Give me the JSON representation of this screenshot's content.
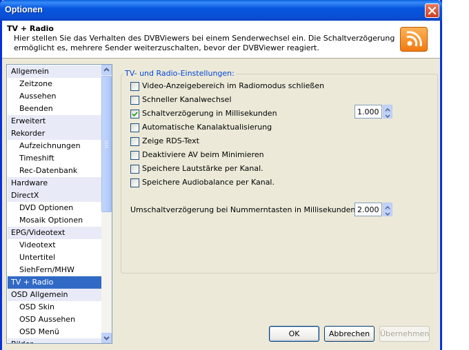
{
  "window": {
    "title": "Optionen"
  },
  "header": {
    "title": "TV + Radio",
    "description": "Hier stellen Sie das Verhalten des DVBViewers bei einem Senderwechsel ein. Die Schaltverzögerung ermöglicht es, mehrere Sender weiterzuschalten, bevor der DVBViewer reagiert."
  },
  "nav": {
    "items": [
      {
        "label": "Allgemein",
        "level": "cat"
      },
      {
        "label": "Zeitzone",
        "level": "sub"
      },
      {
        "label": "Aussehen",
        "level": "sub"
      },
      {
        "label": "Beenden",
        "level": "sub"
      },
      {
        "label": "Erweitert",
        "level": "cat"
      },
      {
        "label": "Rekorder",
        "level": "cat"
      },
      {
        "label": "Aufzeichnungen",
        "level": "sub"
      },
      {
        "label": "Timeshift",
        "level": "sub"
      },
      {
        "label": "Rec-Datenbank",
        "level": "sub"
      },
      {
        "label": "Hardware",
        "level": "cat"
      },
      {
        "label": "DirectX",
        "level": "cat"
      },
      {
        "label": "DVD Optionen",
        "level": "sub"
      },
      {
        "label": "Mosaik Optionen",
        "level": "sub"
      },
      {
        "label": "EPG/Videotext",
        "level": "cat"
      },
      {
        "label": "Videotext",
        "level": "sub"
      },
      {
        "label": "Untertitel",
        "level": "sub"
      },
      {
        "label": "SiehFern/MHW",
        "level": "sub"
      },
      {
        "label": "TV + Radio",
        "level": "sel"
      },
      {
        "label": "OSD Allgemein",
        "level": "cat"
      },
      {
        "label": "OSD Skin",
        "level": "sub"
      },
      {
        "label": "OSD Aussehen",
        "level": "sub"
      },
      {
        "label": "OSD Menü",
        "level": "sub"
      },
      {
        "label": "Bilder",
        "level": "cat"
      }
    ],
    "selected": "TV + Radio"
  },
  "group": {
    "legend": "TV- und Radio-Einstellungen:",
    "checkboxes": [
      {
        "label": "Video-Anzeigebereich im Radiomodus schließen",
        "checked": false
      },
      {
        "label": "Schneller Kanalwechsel",
        "checked": false
      },
      {
        "label": "Schaltverzögerung in Millisekunden",
        "checked": true
      },
      {
        "label": "Automatische Kanalaktualisierung",
        "checked": false
      },
      {
        "label": "Zeige RDS-Text",
        "checked": false
      },
      {
        "label": "Deaktiviere AV beim Minimieren",
        "checked": false
      },
      {
        "label": "Speichere Lautstärke per Kanal.",
        "checked": false
      },
      {
        "label": "Speichere Audiobalance per Kanal.",
        "checked": false
      }
    ],
    "delay_value": "1.000",
    "numkey_label": "Umschaltverzögerung bei Nummerntasten in Millisekunden",
    "numkey_value": "2.000"
  },
  "buttons": {
    "ok": "OK",
    "cancel": "Abbrechen",
    "apply": "Übernehmen"
  },
  "icons": {
    "header_icon": "rss-broadcast-icon",
    "close": "close-icon"
  },
  "colors": {
    "titlebar": "#0a5fe0",
    "selection": "#316ac5",
    "legend": "#0046d5"
  }
}
